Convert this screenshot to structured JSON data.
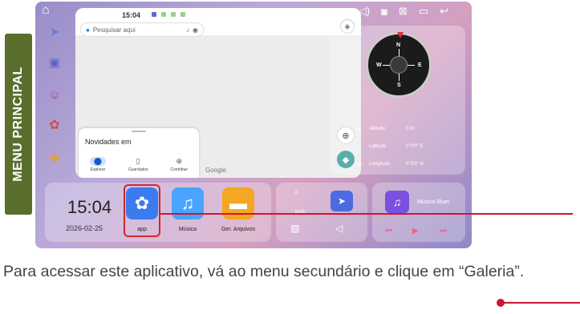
{
  "side_tab": {
    "label": "MENU PRINCIPAL"
  },
  "status": {
    "time": "15:04"
  },
  "map": {
    "search_placeholder": "Pesquisar aqui",
    "sheet_title": "Novidades em",
    "tabs": [
      {
        "label": "Explorar"
      },
      {
        "label": "Guardados"
      },
      {
        "label": "Contribuir"
      }
    ],
    "brand": "Google"
  },
  "compass": {
    "n": "N",
    "s": "S",
    "w": "W",
    "e": "E",
    "rows": [
      {
        "label": "Altitude",
        "value": "0 M"
      },
      {
        "label": "Latitude",
        "value": "0°0'0'' E"
      },
      {
        "label": "Longitude",
        "value": "0°0'0'' N"
      }
    ]
  },
  "clock_card": {
    "time": "15:04",
    "date": "2026-02-25"
  },
  "apps": [
    {
      "label": "app",
      "color": "#3b7bf0"
    },
    {
      "label": "Música",
      "color": "#4aa3ff"
    },
    {
      "label": "Ger. Arquivos",
      "color": "#f5a623"
    }
  ],
  "speed": {
    "value": "0",
    "unit": "km/h"
  },
  "music": {
    "title": "Música Bluet"
  },
  "caption": "Para acessar este aplicativo, vá ao menu secundário e clique em “Galeria”."
}
